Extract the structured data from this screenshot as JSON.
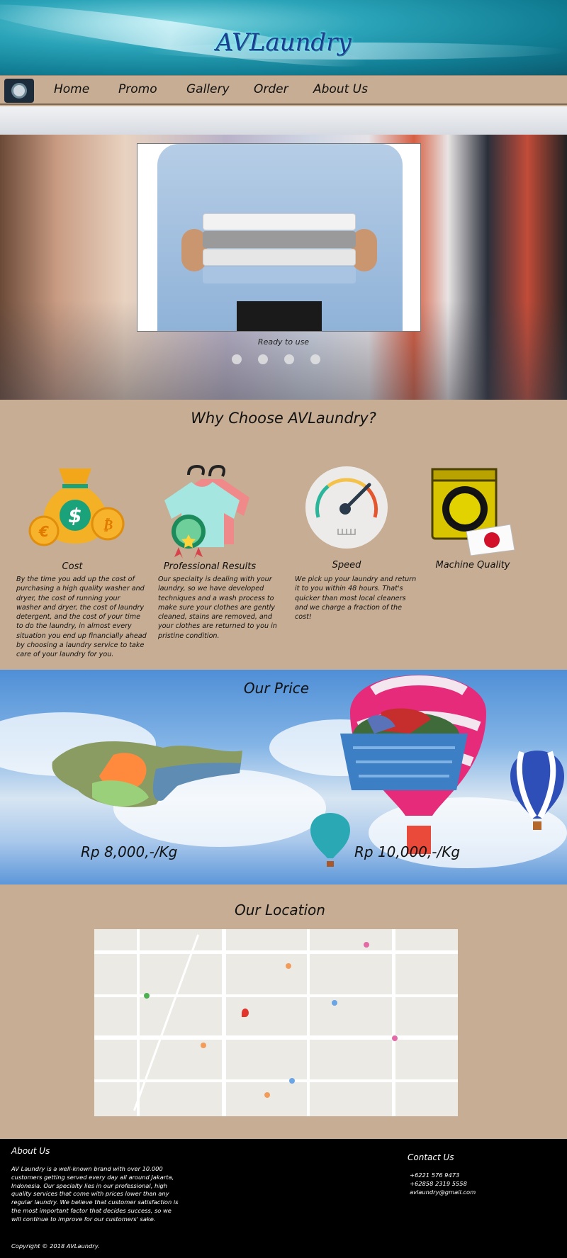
{
  "header": {
    "brand": "AVLaundry"
  },
  "nav": {
    "items": [
      {
        "label": "Home"
      },
      {
        "label": "Promo"
      },
      {
        "label": "Gallery"
      },
      {
        "label": "Order"
      },
      {
        "label": "About Us"
      }
    ]
  },
  "hero": {
    "caption": "Ready to use",
    "slide_count": 4
  },
  "why": {
    "title": "Why Choose AVLaundry?",
    "features": [
      {
        "icon": "money-bag-icon",
        "title": "Cost",
        "text": "By the time you add up the cost of purchasing a high quality washer and dryer, the cost of running your washer and dryer, the cost of laundry detergent, and the cost of your time to do the laundry, in almost every situation you end up financially ahead by choosing a laundry service to take care of your laundry for you."
      },
      {
        "icon": "shirt-award-icon",
        "title": "Professional Results",
        "text": "Our specialty is dealing with your laundry, so we have developed techniques and a wash process to make sure your clothes are gently cleaned, stains are removed, and your clothes are returned to you in pristine condition."
      },
      {
        "icon": "speedometer-icon",
        "title": "Speed",
        "text": "We pick up your laundry and return it to you within 48 hours.  That's quicker than most local cleaners and we charge a fraction of the cost!"
      },
      {
        "icon": "washing-machine-japan-icon",
        "title": "Machine Quality",
        "text": ""
      }
    ]
  },
  "price": {
    "title": "Our Price",
    "items": [
      {
        "label": "Rp 8,000,-/Kg"
      },
      {
        "label": "Rp 10,000,-/Kg"
      }
    ]
  },
  "location": {
    "title": "Our Location"
  },
  "footer": {
    "about_title": "About Us",
    "about_text": "AV Laundry is a well-known brand with over 10.000 customers getting served every day all around Jakarta, Indonesia. Our specialty lies in our professional, high quality services that come with prices lower than any regular laundry. We believe that customer satisfaction is the most important factor that decides success, so we will continue to improve for our customers' sake.",
    "copyright": "Copyright © 2018 AVLaundry.",
    "contact_title": "Contact Us",
    "phone1": "+6221 576 9473",
    "phone2": "+62858 2319 5558",
    "email": "avlaundry@gmail.com"
  },
  "colors": {
    "page_bg": "#c6ad93",
    "footer_bg": "#000000",
    "brand_text": "#1b3d8f"
  }
}
